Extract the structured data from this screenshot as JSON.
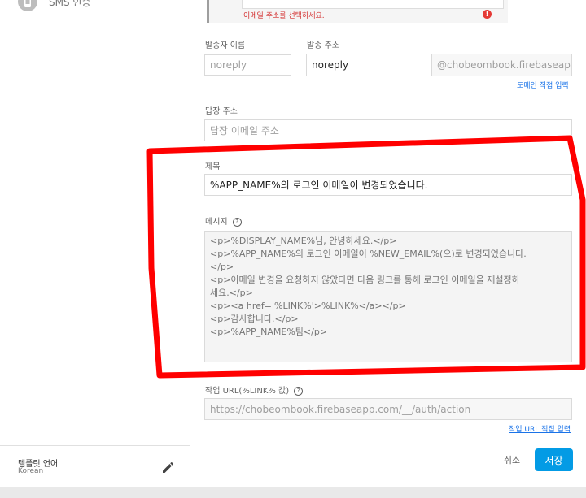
{
  "sidebar": {
    "sms_label": "SMS 인증",
    "template_language_title": "템플릿 언어",
    "template_language_value": "Korean"
  },
  "top": {
    "email_error": "이메일 주소를 선택하세요.",
    "error_icon": "!"
  },
  "form": {
    "sender_name_label": "발송자 이름",
    "sender_name_placeholder": "noreply",
    "sender_address_label": "발송 주소",
    "sender_address_value": "noreply",
    "sender_domain": "@chobeombook.firebaseapp.com",
    "custom_domain_link": "도메인 직접 입력",
    "reply_label": "답장 주소",
    "reply_placeholder": "답장 이메일 주소",
    "subject_label": "제목",
    "subject_value": "%APP_NAME%의 로그인 이메일이 변경되었습니다.",
    "message_label": "메시지",
    "message_lines": [
      "<p>%DISPLAY_NAME%님, 안녕하세요.</p>",
      "<p>%APP_NAME%의 로그인 이메일이 %NEW_EMAIL%(으)로 변경되었습니다.",
      "</p>",
      "<p>이메일 변경을 요청하지 않았다면 다음 링크를 통해 로그인 이메일을 재설정하",
      "세요.</p>",
      "<p><a href='%LINK%'>%LINK%</a></p>",
      "<p>감사합니다.</p>",
      "<p>%APP_NAME%팀</p>"
    ],
    "action_url_label": "작업 URL(%LINK% 값)",
    "action_url_value": "https://chobeombook.firebaseapp.com/__/auth/action",
    "custom_action_url_link": "작업 URL 직접 입력",
    "help_glyph": "?"
  },
  "buttons": {
    "cancel": "취소",
    "save": "저장"
  },
  "colors": {
    "accent": "#039be5",
    "link": "#1a73e8",
    "error": "#d32f2f",
    "annotation": "#ff0000"
  }
}
